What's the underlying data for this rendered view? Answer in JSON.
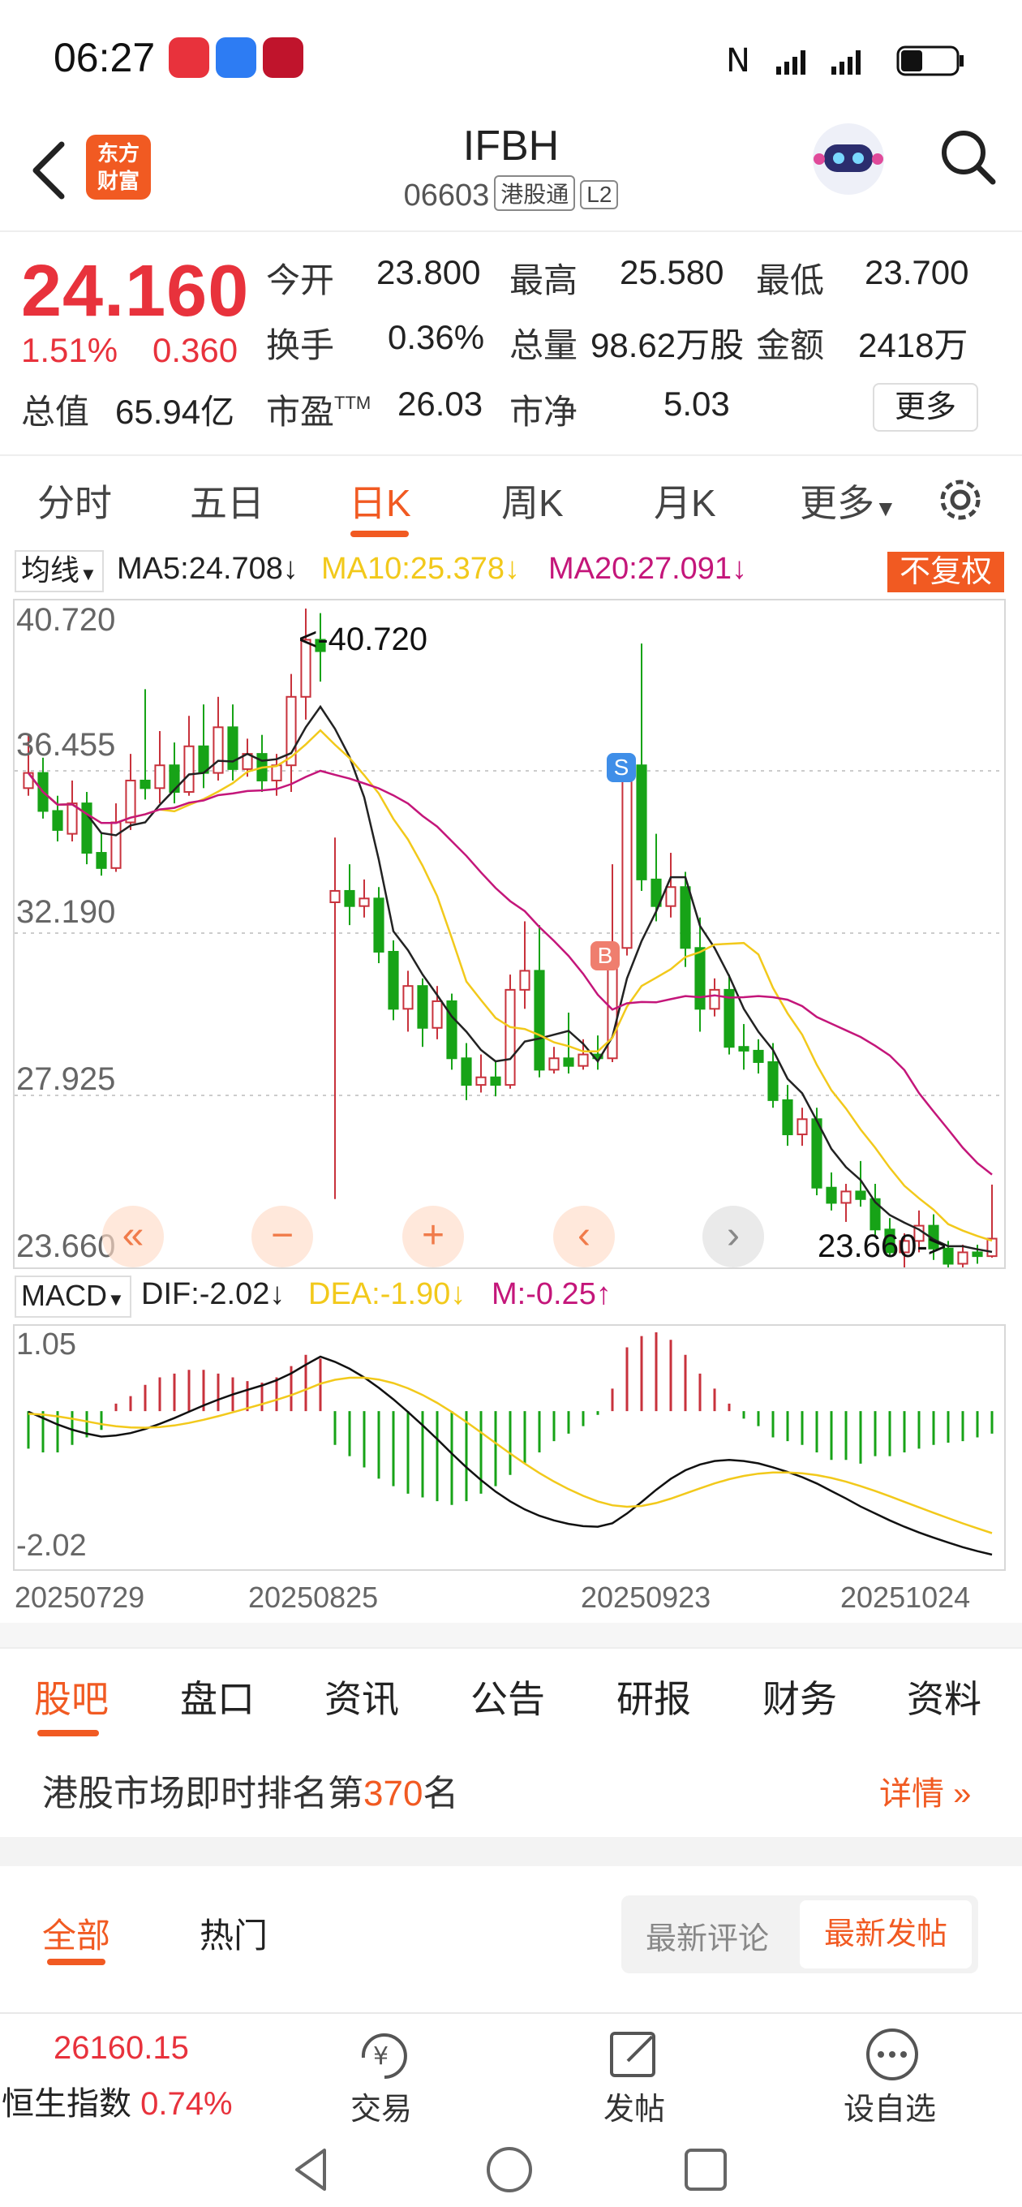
{
  "status_bar": {
    "time": "06:27",
    "app_gallery_label": "App Gallery"
  },
  "header": {
    "stock_name": "IFBH",
    "stock_code": "06603",
    "connect_badge": "港股通",
    "level_badge": "L2",
    "logo_line1": "东方",
    "logo_line2": "财富"
  },
  "quote": {
    "price": "24.160",
    "change_pct": "1.51%",
    "change_amt": "0.360",
    "open_label": "今开",
    "open_value": "23.800",
    "high_label": "最高",
    "high_value": "25.580",
    "low_label": "最低",
    "low_value": "23.700",
    "turnover_label": "换手",
    "turnover_value": "0.36%",
    "volume_label": "总量",
    "volume_value": "98.62万股",
    "amount_label": "金额",
    "amount_value": "2418万",
    "mktcap_label": "总值",
    "mktcap_value": "65.94亿",
    "pe_label": "市盈",
    "pe_sup": "TTM",
    "pe_value": "26.03",
    "pb_label": "市净",
    "pb_value": "5.03",
    "more_button": "更多"
  },
  "kline_tabs": {
    "items": [
      "分时",
      "五日",
      "日K",
      "周K",
      "月K"
    ],
    "more_label": "更多",
    "active_index": 2
  },
  "ma_bar": {
    "selector_label": "均线",
    "ma5": "MA5:24.708",
    "ma10": "MA10:25.378",
    "ma20": "MA20:27.091",
    "arrow": "↓",
    "adjust_button": "不复权",
    "colors": {
      "ma5": "#222222",
      "ma10": "#f2c91b",
      "ma20": "#c4167a"
    }
  },
  "kline": {
    "y_labels": [
      "40.720",
      "36.455",
      "32.190",
      "27.925",
      "23.660"
    ],
    "high_marker": "<-40.720",
    "low_marker": "23.660->",
    "sell_tag": "S",
    "buy_tag": "B"
  },
  "macd_bar": {
    "selector_label": "MACD",
    "dif": "DIF:-2.02",
    "dea": "DEA:-1.90",
    "m": "M:-0.25",
    "dif_arrow": "↓",
    "dea_arrow": "↓",
    "m_arrow": "↑",
    "y_top": "1.05",
    "y_bottom": "-2.02"
  },
  "dates": [
    "20250729",
    "20250825",
    "20250923",
    "20251024"
  ],
  "chart_data": {
    "type": "candlestick",
    "ylim": [
      23.66,
      40.72
    ],
    "candles": [
      [
        36.0,
        36.4,
        37.4,
        35.8
      ],
      [
        36.4,
        35.4,
        36.8,
        35.2
      ],
      [
        35.4,
        34.9,
        35.8,
        34.6
      ],
      [
        34.8,
        35.6,
        36.2,
        34.6
      ],
      [
        35.6,
        34.3,
        35.9,
        34.0
      ],
      [
        34.3,
        33.9,
        34.8,
        33.7
      ],
      [
        33.9,
        35.1,
        35.6,
        33.8
      ],
      [
        35.1,
        36.2,
        36.9,
        34.9
      ],
      [
        36.2,
        36.0,
        38.6,
        35.7
      ],
      [
        36.0,
        36.6,
        37.5,
        35.6
      ],
      [
        36.6,
        35.9,
        37.2,
        35.6
      ],
      [
        35.9,
        37.1,
        37.9,
        35.8
      ],
      [
        37.1,
        36.4,
        38.2,
        36.0
      ],
      [
        36.4,
        37.6,
        38.4,
        36.2
      ],
      [
        37.6,
        36.5,
        38.2,
        36.2
      ],
      [
        36.5,
        36.9,
        37.3,
        36.3
      ],
      [
        36.9,
        36.2,
        37.4,
        35.9
      ],
      [
        36.2,
        36.6,
        36.9,
        35.8
      ],
      [
        36.6,
        38.4,
        39.0,
        35.9
      ],
      [
        38.4,
        39.9,
        40.72,
        37.8
      ],
      [
        39.9,
        39.6,
        40.6,
        38.8
      ],
      [
        33.0,
        33.3,
        34.7,
        25.2
      ],
      [
        33.3,
        32.9,
        34.0,
        32.4
      ],
      [
        32.9,
        33.1,
        33.6,
        32.6
      ],
      [
        33.1,
        31.7,
        33.4,
        31.4
      ],
      [
        31.7,
        30.2,
        32.0,
        29.9
      ],
      [
        30.2,
        30.8,
        31.2,
        29.6
      ],
      [
        30.8,
        29.7,
        31.0,
        29.2
      ],
      [
        29.7,
        30.4,
        30.8,
        29.4
      ],
      [
        30.4,
        28.9,
        30.6,
        28.6
      ],
      [
        28.9,
        28.2,
        29.3,
        27.8
      ],
      [
        28.2,
        28.4,
        29.0,
        28.0
      ],
      [
        28.4,
        28.2,
        28.8,
        27.9
      ],
      [
        28.2,
        30.7,
        31.1,
        28.1
      ],
      [
        30.7,
        31.2,
        32.5,
        30.2
      ],
      [
        31.2,
        28.6,
        32.4,
        28.4
      ],
      [
        28.6,
        28.9,
        29.2,
        28.5
      ],
      [
        28.9,
        28.7,
        30.1,
        28.5
      ],
      [
        28.7,
        29.0,
        29.4,
        28.6
      ],
      [
        29.0,
        28.9,
        29.5,
        28.6
      ],
      [
        28.9,
        31.8,
        34.0,
        28.8
      ],
      [
        31.8,
        36.6,
        36.6,
        31.6
      ],
      [
        36.6,
        33.6,
        39.8,
        33.3
      ],
      [
        33.6,
        32.9,
        34.8,
        32.5
      ],
      [
        32.9,
        33.4,
        34.3,
        32.6
      ],
      [
        33.4,
        31.8,
        33.8,
        31.3
      ],
      [
        31.8,
        30.2,
        32.6,
        29.6
      ],
      [
        30.2,
        30.7,
        31.0,
        30.0
      ],
      [
        30.7,
        29.2,
        31.1,
        29.0
      ],
      [
        29.2,
        29.1,
        29.8,
        28.6
      ],
      [
        29.1,
        28.8,
        29.4,
        28.5
      ],
      [
        28.8,
        27.8,
        29.3,
        27.6
      ],
      [
        27.8,
        26.9,
        28.2,
        26.6
      ],
      [
        26.9,
        27.3,
        27.6,
        26.6
      ],
      [
        27.3,
        25.5,
        27.6,
        25.3
      ],
      [
        25.5,
        25.1,
        25.9,
        24.9
      ],
      [
        25.1,
        25.4,
        25.6,
        24.6
      ],
      [
        25.4,
        25.2,
        26.2,
        25.0
      ],
      [
        25.2,
        24.4,
        25.6,
        24.2
      ],
      [
        24.4,
        23.8,
        24.7,
        23.7
      ],
      [
        23.8,
        24.1,
        24.3,
        23.4
      ],
      [
        24.1,
        24.5,
        24.9,
        23.8
      ],
      [
        24.5,
        23.9,
        24.8,
        23.6
      ],
      [
        23.9,
        23.5,
        24.1,
        23.3
      ],
      [
        23.5,
        23.8,
        24.0,
        23.3
      ],
      [
        23.8,
        23.7,
        24.0,
        23.5
      ],
      [
        23.7,
        24.16,
        25.58,
        23.66
      ]
    ],
    "macd_hist": [
      -0.5,
      -0.55,
      -0.55,
      -0.45,
      -0.35,
      -0.25,
      0.1,
      0.2,
      0.35,
      0.45,
      0.5,
      0.55,
      0.55,
      0.5,
      0.45,
      0.4,
      0.38,
      0.45,
      0.6,
      0.75,
      0.7,
      -0.45,
      -0.6,
      -0.75,
      -0.9,
      -1.0,
      -1.1,
      -1.15,
      -1.2,
      -1.25,
      -1.2,
      -1.1,
      -1.0,
      -0.85,
      -0.7,
      -0.55,
      -0.4,
      -0.3,
      -0.2,
      -0.05,
      0.3,
      0.85,
      1.0,
      1.05,
      0.95,
      0.75,
      0.5,
      0.3,
      0.1,
      -0.1,
      -0.2,
      -0.35,
      -0.4,
      -0.45,
      -0.55,
      -0.65,
      -0.65,
      -0.7,
      -0.6,
      -0.6,
      -0.55,
      -0.5,
      -0.45,
      -0.42,
      -0.4,
      -0.35,
      -0.3
    ],
    "macd_ylim": [
      -2.02,
      1.05
    ]
  },
  "lower_tabs": [
    "股吧",
    "盘口",
    "资讯",
    "公告",
    "研报",
    "财务",
    "资料"
  ],
  "rank": {
    "prefix": "港股市场即时排名第",
    "number": "370",
    "suffix": "名",
    "detail": "详情"
  },
  "feed": {
    "tab_all": "全部",
    "tab_hot": "热门",
    "sort_comment": "最新评论",
    "sort_post": "最新发帖"
  },
  "bottom_bar": {
    "index_value": "26160.15",
    "index_name": "恒生指数",
    "index_change": "0.74%",
    "trade_label": "交易",
    "post_label": "发帖",
    "watchlist_label": "设自选"
  }
}
